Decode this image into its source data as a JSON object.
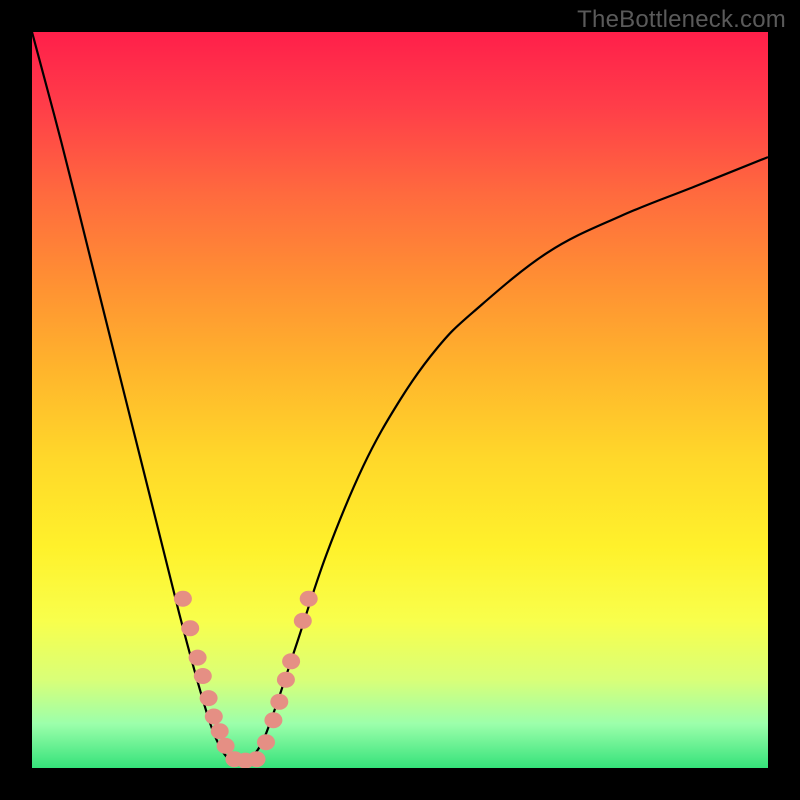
{
  "watermark": "TheBottleneck.com",
  "chart_data": {
    "type": "line",
    "title": "",
    "xlabel": "",
    "ylabel": "",
    "xlim": [
      0,
      100
    ],
    "ylim": [
      0,
      100
    ],
    "grid": false,
    "curve_hint": "V-shaped bottleneck curve; minimum (~0) near x≈27–30; rises steeply to ~100 at x≈0 and asymptotically toward ~83 at x≈100",
    "series": [
      {
        "name": "bottleneck-curve",
        "x": [
          0,
          4,
          8,
          12,
          16,
          20,
          23,
          25,
          27,
          29,
          31,
          33,
          36,
          40,
          45,
          50,
          55,
          60,
          70,
          80,
          90,
          100
        ],
        "y": [
          100,
          85,
          69,
          53,
          37,
          21,
          10,
          4,
          1,
          1,
          3,
          8,
          17,
          29,
          41,
          50,
          57,
          62,
          70,
          75,
          79,
          83
        ]
      }
    ],
    "markers": {
      "name": "highlight-points",
      "color": "#e58f84",
      "points": [
        {
          "x": 20.5,
          "y": 23
        },
        {
          "x": 21.5,
          "y": 19
        },
        {
          "x": 22.5,
          "y": 15
        },
        {
          "x": 23.2,
          "y": 12.5
        },
        {
          "x": 24.0,
          "y": 9.5
        },
        {
          "x": 24.7,
          "y": 7
        },
        {
          "x": 25.5,
          "y": 5
        },
        {
          "x": 26.3,
          "y": 3
        },
        {
          "x": 27.5,
          "y": 1.2
        },
        {
          "x": 29.0,
          "y": 1.0
        },
        {
          "x": 30.5,
          "y": 1.2
        },
        {
          "x": 31.8,
          "y": 3.5
        },
        {
          "x": 32.8,
          "y": 6.5
        },
        {
          "x": 33.6,
          "y": 9
        },
        {
          "x": 34.5,
          "y": 12
        },
        {
          "x": 35.2,
          "y": 14.5
        },
        {
          "x": 36.8,
          "y": 20
        },
        {
          "x": 37.6,
          "y": 23
        }
      ]
    }
  }
}
